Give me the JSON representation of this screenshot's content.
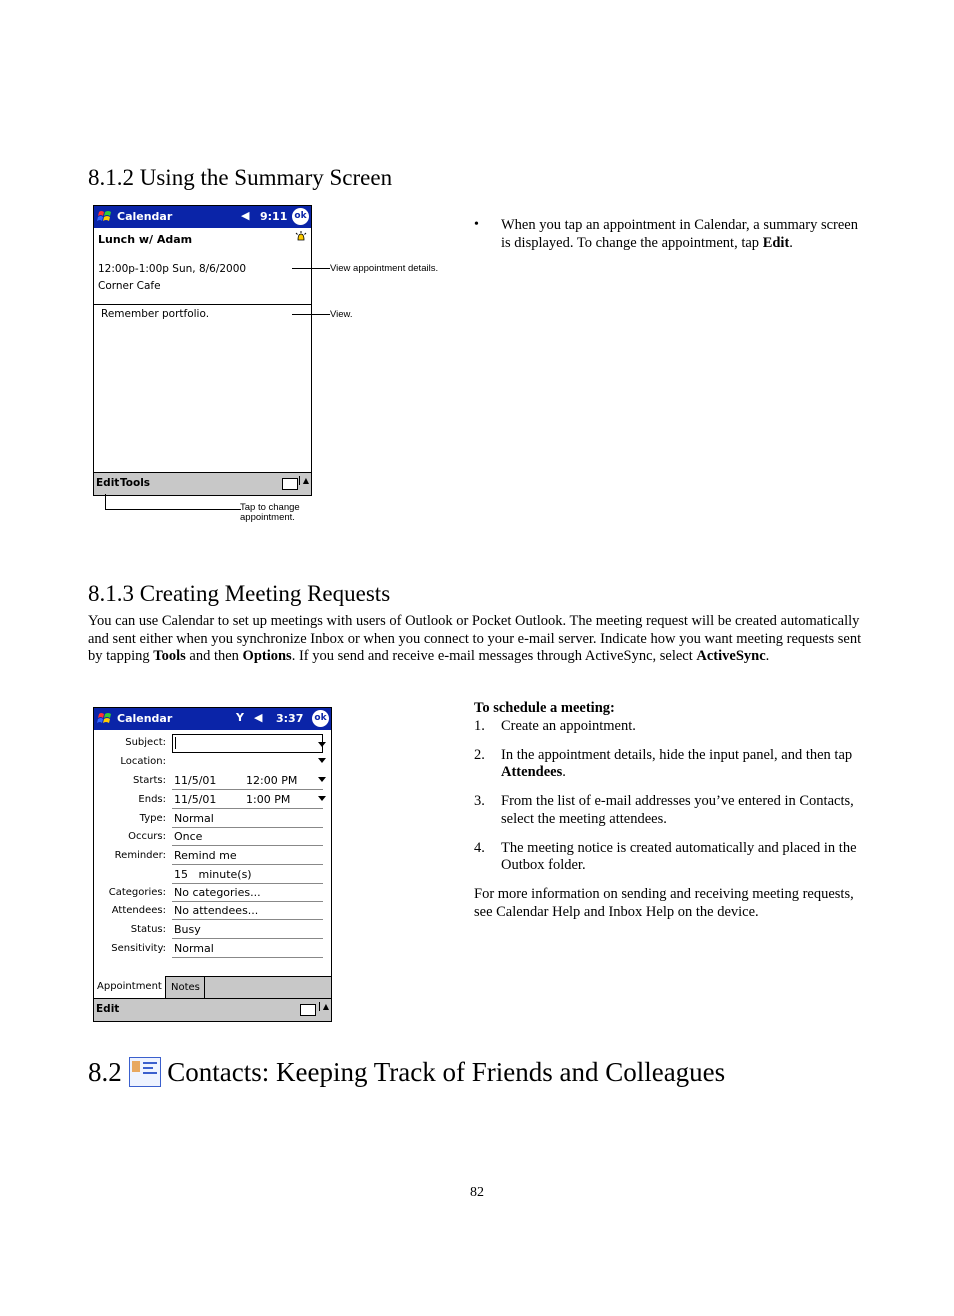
{
  "section_812": {
    "heading": "8.1.2 Using the Summary Screen",
    "bullet": "When you tap an appointment in Calendar, a summary screen is displayed. To change the appointment, tap ",
    "bullet_bold": "Edit",
    "bullet_end": "."
  },
  "screen1": {
    "title": "Calendar",
    "time": "9:11",
    "ok": "ok",
    "subject": "Lunch w/ Adam",
    "datetime": "12:00p-1:00p Sun, 8/6/2000",
    "location": "Corner Cafe",
    "notes": "Remember portfolio.",
    "menu_edit": "Edit",
    "menu_tools": "Tools",
    "callout_details": "View appointment details.",
    "callout_view": "View.",
    "callout_tap_line1": "Tap to change",
    "callout_tap_line2": "appointment."
  },
  "section_813": {
    "heading": "8.1.3 Creating Meeting Requests",
    "para_a": "You can use Calendar to set up meetings with users of Outlook or Pocket Outlook. The meeting request will be created automatically and sent either when you synchronize Inbox or when you connect to your e-mail server. Indicate how you want meeting requests sent by tapping ",
    "para_tools": "Tools",
    "para_b": " and then ",
    "para_options": "Options",
    "para_c": ". If you send and receive e-mail messages through ActiveSync, select ",
    "para_activesync": "ActiveSync",
    "para_d": ".",
    "procedure_title": "To schedule a meeting:",
    "steps": [
      {
        "num": "1.",
        "text": "Create an appointment.",
        "bold": "",
        "after": ""
      },
      {
        "num": "2.",
        "text": "In the appointment details, hide the input panel, and then tap ",
        "bold": "Attendees",
        "after": "."
      },
      {
        "num": "3.",
        "text": "From the list of e-mail addresses you’ve entered in Contacts, select the meeting attendees.",
        "bold": "",
        "after": ""
      },
      {
        "num": "4.",
        "text": "The meeting notice is created automatically and placed in the Outbox folder.",
        "bold": "",
        "after": ""
      }
    ],
    "more_info": "For more information on sending and receiving meeting requests, see Calendar Help and Inbox Help on the device."
  },
  "screen2": {
    "title": "Calendar",
    "time": "3:37",
    "ok": "ok",
    "fields": [
      {
        "label": "Subject:",
        "value": "",
        "dropdown": true
      },
      {
        "label": "Location:",
        "value": "",
        "dropdown": true
      },
      {
        "label": "Starts:",
        "value": "11/5/01",
        "value2": "12:00 PM",
        "dropdown": true
      },
      {
        "label": "Ends:",
        "value": "11/5/01",
        "value2": "1:00 PM",
        "dropdown": true
      },
      {
        "label": "Type:",
        "value": "Normal"
      },
      {
        "label": "Occurs:",
        "value": "Once"
      },
      {
        "label": "Reminder:",
        "value": "Remind me"
      },
      {
        "label": "",
        "value": "15   minute(s)"
      },
      {
        "label": "Categories:",
        "value": "No categories..."
      },
      {
        "label": "Attendees:",
        "value": "No attendees..."
      },
      {
        "label": "Status:",
        "value": "Busy"
      },
      {
        "label": "Sensitivity:",
        "value": "Normal"
      }
    ],
    "tab_appointment": "Appointment",
    "tab_notes": "Notes",
    "menu_edit": "Edit"
  },
  "section_82": {
    "number": "8.2",
    "heading": "Contacts: Keeping Track of Friends and Colleagues",
    "icon": "contacts-icon"
  },
  "page_number": "82",
  "colors": {
    "title_bar": "#0a24a8",
    "menu_bar": "#c8c8c8"
  }
}
